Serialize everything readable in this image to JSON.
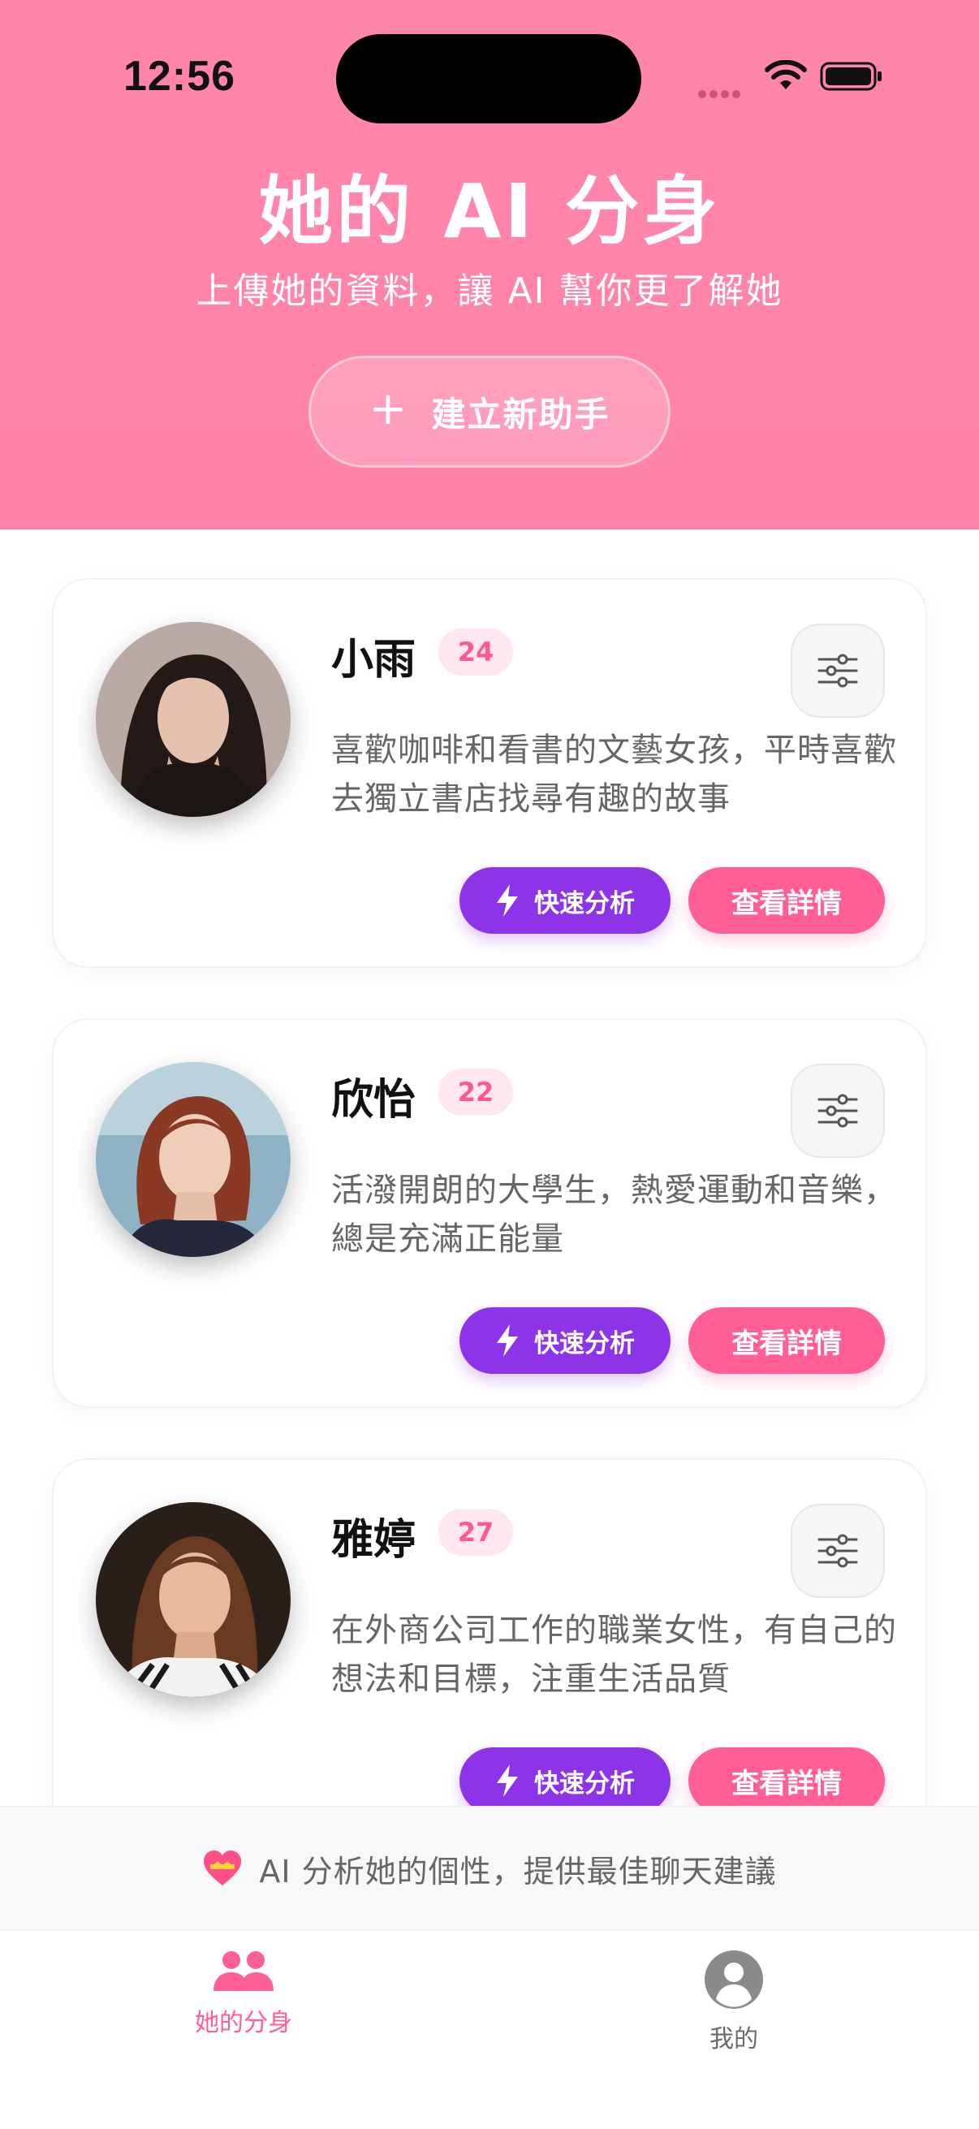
{
  "status_bar": {
    "time": "12:56"
  },
  "header": {
    "title": "她的 AI 分身",
    "subtitle": "上傳她的資料，讓 AI 幫你更了解她",
    "create_button": {
      "icon": "plus-icon",
      "label": "建立新助手"
    }
  },
  "profiles": [
    {
      "name": "小雨",
      "age": "24",
      "description": "喜歡咖啡和看書的文藝女孩，平時喜歡去獨立書店找尋有趣的故事",
      "quick_label": "快速分析",
      "detail_label": "查看詳情"
    },
    {
      "name": "欣怡",
      "age": "22",
      "description": "活潑開朗的大學生，熱愛運動和音樂，總是充滿正能量",
      "quick_label": "快速分析",
      "detail_label": "查看詳情"
    },
    {
      "name": "雅婷",
      "age": "27",
      "description": "在外商公司工作的職業女性，有自己的想法和目標，注重生活品質",
      "quick_label": "快速分析",
      "detail_label": "查看詳情"
    }
  ],
  "banner": {
    "icon": "heart-icon",
    "text": "AI 分析她的個性，提供最佳聊天建議"
  },
  "tab_bar": {
    "tabs": [
      {
        "label": "她的分身",
        "icon": "people-icon",
        "active": true
      },
      {
        "label": "我的",
        "icon": "person-icon",
        "active": false
      }
    ]
  },
  "colors": {
    "header_pink": "#ff86ab",
    "accent_pink": "#ff5f94",
    "accent_purple": "#8e34e8",
    "badge_bg": "#ffe6ef"
  }
}
